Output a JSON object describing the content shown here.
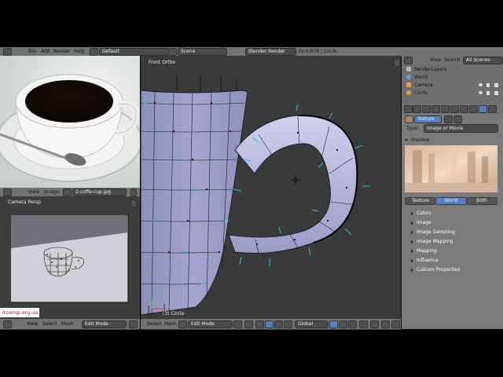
{
  "topbar": {
    "menus": [
      "File",
      "Add",
      "Render",
      "Help"
    ],
    "layout": "Default",
    "scene": "Scene",
    "engine": "Blender Render",
    "stats": "Fa:0-678 | Circle"
  },
  "image_editor": {
    "menus": [
      "View",
      "Image"
    ],
    "filename": "2-coffe-cup.jpg"
  },
  "camera_view": {
    "label": "Camera Persp",
    "footer_menus": [
      "View",
      "Select",
      "Mesh"
    ],
    "mode": "Edit Mode"
  },
  "main_view": {
    "label": "Front Ortho",
    "object_label": "(3) Circle",
    "footer_menus": [
      "Select",
      "Mesh"
    ],
    "mode": "Edit Mode",
    "orientation": "Global"
  },
  "outliner": {
    "menus": [
      "View",
      "Search"
    ],
    "filter": "All Scenes",
    "items": [
      "RenderLayers",
      "World",
      "Camera",
      "Circle"
    ]
  },
  "properties": {
    "tab": "Texture",
    "type_label": "Type:",
    "type_value": "Image or Movie",
    "preview_label": "Preview",
    "preview_tabs": [
      "Texture",
      "World",
      "Both"
    ],
    "active_preview_tab": "World",
    "sections": [
      "Colors",
      "Image",
      "Image Sampling",
      "Image Mapping",
      "Mapping",
      "Influence",
      "Custom Properties"
    ]
  },
  "watermark": "itcomp.org.ua",
  "colors": {
    "accent": "#5680c2",
    "bg": "#727272",
    "viewport": "#3a3a3a"
  }
}
